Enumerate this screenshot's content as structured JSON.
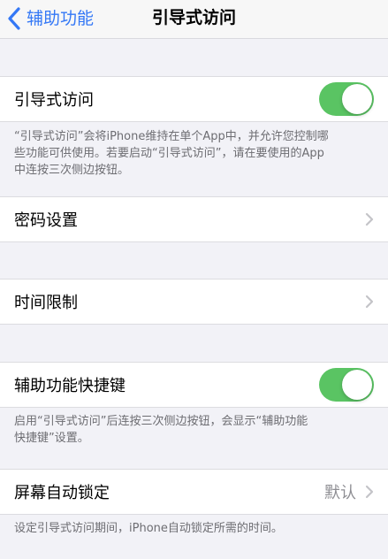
{
  "nav": {
    "back_label": "辅助功能",
    "title": "引导式访问"
  },
  "rows": {
    "guided_access": {
      "label": "引导式访问",
      "toggle_on": true
    },
    "passcode": {
      "label": "密码设置"
    },
    "time_limits": {
      "label": "时间限制"
    },
    "accessibility_shortcut": {
      "label": "辅助功能快捷键",
      "toggle_on": true
    },
    "auto_lock": {
      "label": "屏幕自动锁定",
      "value": "默认"
    }
  },
  "footers": {
    "guided_access_line1": "“引导式访问”会将iPhone维持在单个App中，并允许您控制哪",
    "guided_access_line2": "些功能可供使用。若要启动“引导式访问”，请在要使用的App",
    "guided_access_line3": "中连按三次侧边按钮。",
    "shortcut_line1": "启用“引导式访问”后连按三次侧边按钮，会显示“辅助功能",
    "shortcut_line2": "快捷键”设置。",
    "auto_lock_line1": "设定引导式访问期间，iPhone自动锁定所需的时间。"
  },
  "colors": {
    "accent": "#3478f6",
    "toggle_on": "#5ac463",
    "background": "#f2f2f7",
    "secondary_text": "#8e8e93"
  },
  "icons": {
    "back": "chevron-left-icon",
    "disclosure": "chevron-right-icon"
  }
}
